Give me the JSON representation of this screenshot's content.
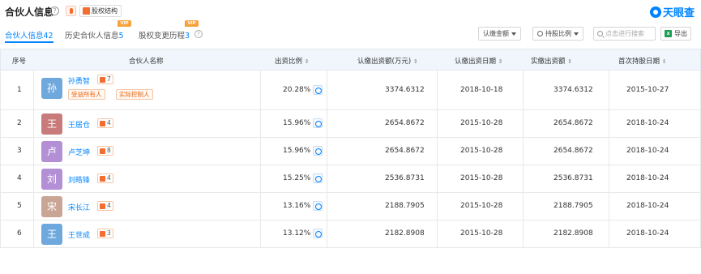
{
  "header": {
    "title": "合伙人信息",
    "help_icon": "?",
    "equity_button": "股权结构",
    "logo_text": "天眼查"
  },
  "tabs": [
    {
      "label": "合伙人信息",
      "count": "42",
      "active": true
    },
    {
      "label": "历史合伙人信息",
      "count": "5",
      "vip": "VIP"
    },
    {
      "label": "股权变更历程",
      "count": "3",
      "vip": "VIP"
    }
  ],
  "controls": {
    "subscribed_filter": "认缴金额",
    "ratio_filter": "持股比例",
    "search_placeholder": "点击进行搜索",
    "export_label": "导出",
    "excel_icon": "x"
  },
  "table": {
    "columns": [
      "序号",
      "合伙人名称",
      "出资比例",
      "认缴出资额(万元)",
      "认缴出资日期",
      "实缴出资额",
      "首次持股日期"
    ],
    "sort_glyph": "⇕",
    "rows": [
      {
        "index": "1",
        "avatar": "孙",
        "avatar_color": "#6fa8dc",
        "name": "孙勇智",
        "related": "7",
        "tags": [
          "受益所有人",
          "实际控制人"
        ],
        "ratio": "20.28%",
        "subscribed": "3374.6312",
        "sub_date": "2018-10-18",
        "paid": "3374.6312",
        "first_date": "2015-10-27"
      },
      {
        "index": "2",
        "avatar": "王",
        "avatar_color": "#c97b7b",
        "name": "王居仓",
        "related": "4",
        "tags": [],
        "ratio": "15.96%",
        "subscribed": "2654.8672",
        "sub_date": "2015-10-28",
        "paid": "2654.8672",
        "first_date": "2018-10-24"
      },
      {
        "index": "3",
        "avatar": "卢",
        "avatar_color": "#b38fd6",
        "name": "卢芝坤",
        "related": "8",
        "tags": [],
        "ratio": "15.96%",
        "subscribed": "2654.8672",
        "sub_date": "2015-10-28",
        "paid": "2654.8672",
        "first_date": "2018-10-24"
      },
      {
        "index": "4",
        "avatar": "刘",
        "avatar_color": "#b38fd6",
        "name": "刘皓锋",
        "related": "4",
        "tags": [],
        "ratio": "15.25%",
        "subscribed": "2536.8731",
        "sub_date": "2015-10-28",
        "paid": "2536.8731",
        "first_date": "2018-10-24"
      },
      {
        "index": "5",
        "avatar": "宋",
        "avatar_color": "#c9a595",
        "name": "宋长江",
        "related": "4",
        "tags": [],
        "ratio": "13.16%",
        "subscribed": "2188.7905",
        "sub_date": "2015-10-28",
        "paid": "2188.7905",
        "first_date": "2018-10-24"
      },
      {
        "index": "6",
        "avatar": "王",
        "avatar_color": "#6fa8dc",
        "name": "王世成",
        "related": "3",
        "tags": [],
        "ratio": "13.12%",
        "subscribed": "2182.8908",
        "sub_date": "2015-10-28",
        "paid": "2182.8908",
        "first_date": "2018-10-24"
      }
    ]
  }
}
